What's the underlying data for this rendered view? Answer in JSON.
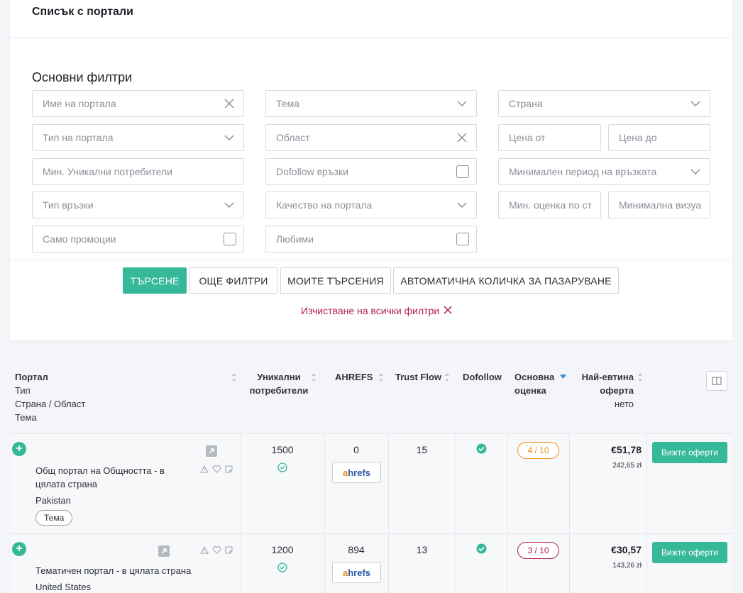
{
  "page": {
    "title": "Списък с портали"
  },
  "filters": {
    "section_title": "Основни филтри",
    "portal_name": "Име на портала",
    "topic": "Тема",
    "country": "Страна",
    "portal_type": "Тип на портала",
    "region": "Област",
    "price_from": "Цена от",
    "price_to": "Цена до",
    "min_unique_users": "Мин. Уникални потребители",
    "dofollow_links": "Dofollow връзки",
    "min_link_period": "Минимален период на връзката",
    "link_type": "Тип връзки",
    "portal_quality": "Качество на портала",
    "min_rating": "Мин. оценка по ст",
    "min_visibility": "Минимална визуа",
    "promotions_only": "Само промоции",
    "favorites": "Любими"
  },
  "actions": {
    "search": "ТЪРСЕНЕ",
    "more_filters": "ОЩЕ ФИЛТРИ",
    "my_searches": "МОИТЕ ТЪРСЕНИЯ",
    "auto_cart": "АВТОМАТИЧНА КОЛИЧКА ЗА ПАЗАРУВАНЕ",
    "clear_all": "Изчистване на всички филтри"
  },
  "table": {
    "headers": {
      "portal": "Портал",
      "type": "Тип",
      "country_region": "Страна / Област",
      "topic": "Тема",
      "unique_users_1": "Уникални",
      "unique_users_2": "потребители",
      "ahrefs": "AHREFS",
      "trust_flow": "Trust Flow",
      "dofollow": "Dofollow",
      "main_rating_1": "Основна",
      "main_rating_2": "оценка",
      "cheapest_1": "Най-евтина",
      "cheapest_2": "оферта",
      "cheapest_3": "нето"
    },
    "rows": [
      {
        "name_line1": "Общ портал на Общността - в",
        "name_line2": "цялата страна",
        "country": "Pakistan",
        "tag": "Тема",
        "unique_users": "1500",
        "ahrefs": "0",
        "trust_flow": "15",
        "score": "4 / 10",
        "score_color": "#f08c1e",
        "price": "€51,78",
        "price_pln": "242,65 zł",
        "offer_button": "Вижте оферти"
      },
      {
        "name_line1": "Тематичен портал - в цялата страна",
        "name_line2": "",
        "country": "United States",
        "tag": "",
        "unique_users": "1200",
        "ahrefs": "894",
        "trust_flow": "13",
        "score": "3 / 10",
        "score_color": "#b3204a",
        "price": "€30,57",
        "price_pln": "143,26 zł",
        "offer_button": "Вижте оферти"
      }
    ],
    "ahrefs_logo_a": "a",
    "ahrefs_logo_rest": "hrefs"
  },
  "colors": {
    "accent": "#35b999",
    "danger": "#b3204a",
    "warning": "#f08c1e"
  }
}
